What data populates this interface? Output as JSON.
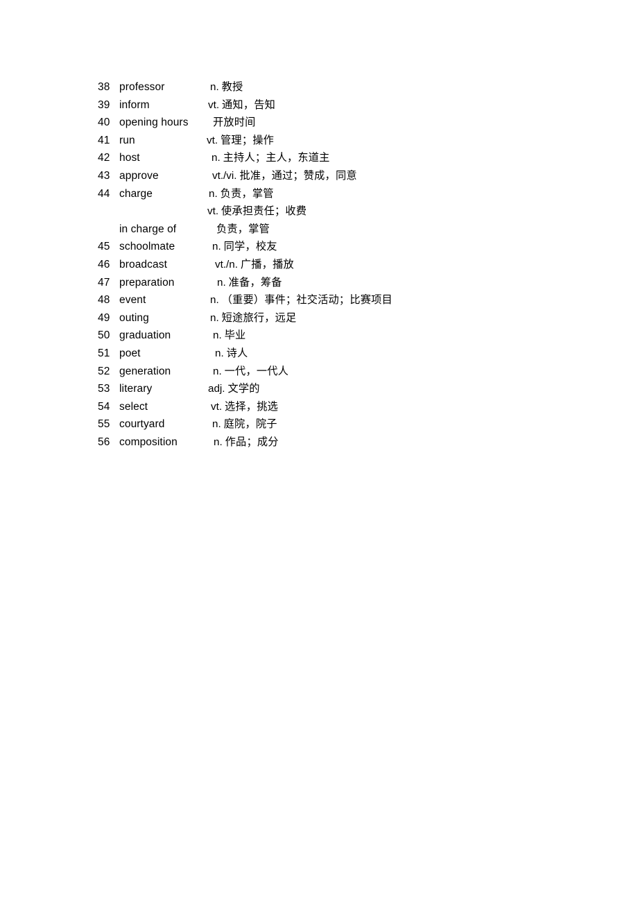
{
  "document": {
    "type": "vocabulary-list",
    "page_background": "#ffffff",
    "text_color": "#000000",
    "entries": [
      {
        "number": "38",
        "word": "professor",
        "pos": "n.",
        "gloss": "教授",
        "def_indent": 303
      },
      {
        "number": "39",
        "word": "inform",
        "pos": "vt.",
        "gloss": "通知，告知",
        "def_indent": 300
      },
      {
        "number": "40",
        "word": "opening hours",
        "pos": "",
        "gloss": "开放时间",
        "def_indent": 307
      },
      {
        "number": "41",
        "word": "run",
        "pos": "vt.",
        "gloss": "管理；操作",
        "def_indent": 298
      },
      {
        "number": "42",
        "word": "host",
        "pos": "n.",
        "gloss": "主持人；主人，东道主",
        "def_indent": 305
      },
      {
        "number": "43",
        "word": "approve",
        "pos": "vt./vi.",
        "gloss": "批准，通过；赞成，同意",
        "def_indent": 306
      },
      {
        "number": "44",
        "word": "charge",
        "pos": "n.",
        "gloss": "负责，掌管",
        "def_indent": 301
      },
      {
        "number": "",
        "word": "",
        "pos": "vt.",
        "gloss": "使承担责任；收费",
        "def_indent": 299
      },
      {
        "number": "",
        "word": "in charge of",
        "pos": "",
        "gloss": "负责，掌管",
        "def_indent": 312
      },
      {
        "number": "45",
        "word": "schoolmate",
        "pos": "n.",
        "gloss": "同学，校友",
        "def_indent": 306
      },
      {
        "number": "46",
        "word": "broadcast",
        "pos": "vt./n.",
        "gloss": "广播，播放",
        "def_indent": 310
      },
      {
        "number": "47",
        "word": "preparation",
        "pos": "n.",
        "gloss": "准备，筹备",
        "def_indent": 313
      },
      {
        "number": "48",
        "word": "event",
        "pos": "n.",
        "gloss": "（重要）事件；社交活动；比赛项目",
        "def_indent": 303
      },
      {
        "number": "49",
        "word": "outing",
        "pos": "n.",
        "gloss": "短途旅行，远足",
        "def_indent": 303
      },
      {
        "number": "50",
        "word": "graduation",
        "pos": "n.",
        "gloss": "毕业",
        "def_indent": 307
      },
      {
        "number": "51",
        "word": "poet",
        "pos": "n.",
        "gloss": "诗人",
        "def_indent": 310
      },
      {
        "number": "52",
        "word": "generation",
        "pos": "n.",
        "gloss": "一代，一代人",
        "def_indent": 307
      },
      {
        "number": "53",
        "word": "literary",
        "pos": "adj.",
        "gloss": "文学的",
        "def_indent": 300
      },
      {
        "number": "54",
        "word": "select",
        "pos": "vt.",
        "gloss": "选择，挑选",
        "def_indent": 304
      },
      {
        "number": "55",
        "word": "courtyard",
        "pos": "n.",
        "gloss": "庭院，院子",
        "def_indent": 306
      },
      {
        "number": "56",
        "word": "composition",
        "pos": "n.",
        "gloss": "作品；成分",
        "def_indent": 308
      }
    ]
  }
}
